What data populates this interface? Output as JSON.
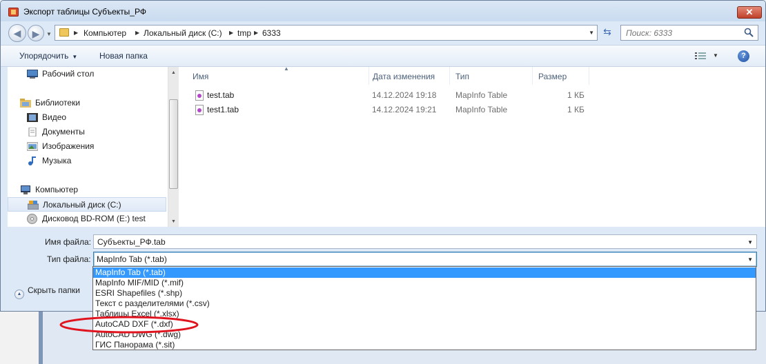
{
  "window": {
    "title": "Экспорт таблицы Субъекты_РФ",
    "close_label": "✕"
  },
  "address": {
    "crumbs": [
      "Компьютер",
      "Локальный диск (C:)",
      "tmp",
      "6333"
    ],
    "search_placeholder": "Поиск: 6333"
  },
  "toolbar": {
    "organize_label": "Упорядочить",
    "new_folder_label": "Новая папка",
    "help_label": "?"
  },
  "navpane": {
    "items": [
      {
        "label": "Рабочий стол",
        "icon": "desktop-icon"
      },
      {
        "label": "Библиотеки",
        "icon": "libraries-icon"
      },
      {
        "label": "Видео",
        "icon": "video-icon"
      },
      {
        "label": "Документы",
        "icon": "documents-icon"
      },
      {
        "label": "Изображения",
        "icon": "pictures-icon"
      },
      {
        "label": "Музыка",
        "icon": "music-icon"
      },
      {
        "label": "Компьютер",
        "icon": "computer-icon"
      },
      {
        "label": "Локальный диск (C:)",
        "icon": "hard-drive-icon"
      },
      {
        "label": "Дисковод BD-ROM (E:) test",
        "icon": "optical-drive-icon"
      }
    ]
  },
  "filelist": {
    "columns": [
      "Имя",
      "Дата изменения",
      "Тип",
      "Размер"
    ],
    "rows": [
      {
        "name": "test.tab",
        "date": "14.12.2024 19:18",
        "type": "MapInfo Table",
        "size": "1 КБ"
      },
      {
        "name": "test1.tab",
        "date": "14.12.2024 19:21",
        "type": "MapInfo Table",
        "size": "1 КБ"
      }
    ]
  },
  "form": {
    "filename_label": "Имя файла:",
    "filename_value": "Субъекты_РФ.tab",
    "filetype_label": "Тип файла:",
    "filetype_value": "MapInfo Tab (*.tab)",
    "hide_folders_label": "Скрыть папки"
  },
  "filetype_options": [
    "MapInfo Tab (*.tab)",
    "MapInfo MIF/MID (*.mif)",
    "ESRI Shapefiles (*.shp)",
    "Текст с разделителями (*.csv)",
    "Таблицы Excel (*.xlsx)",
    "AutoCAD DXF (*.dxf)",
    "AutoCAD DWG (*.dwg)",
    "ГИС Панорама (*.sit)"
  ],
  "colors": {
    "selection": "#3399ff",
    "annotation": "#e0141e"
  }
}
